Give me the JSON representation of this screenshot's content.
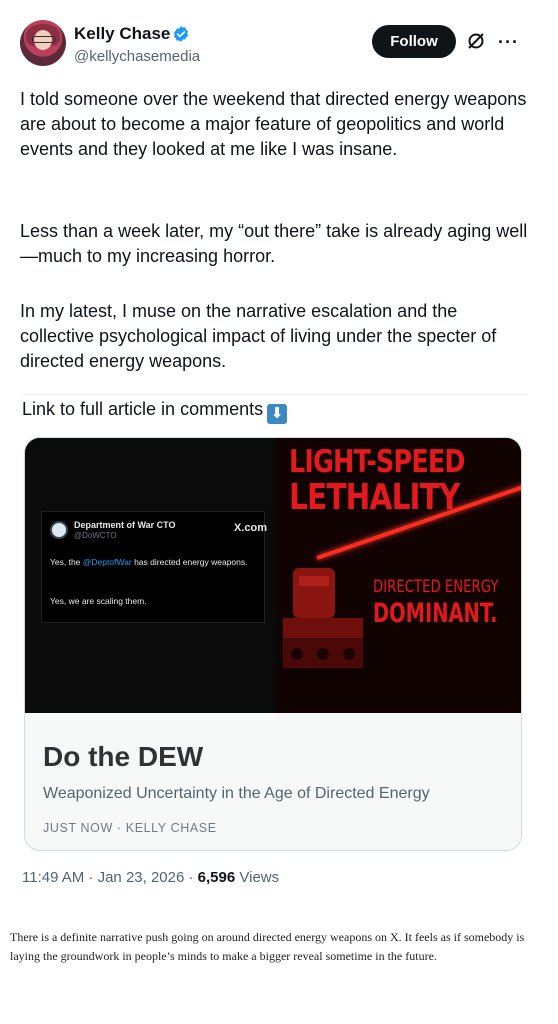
{
  "author": {
    "name": "Kelly Chase",
    "handle": "@kellychasemedia",
    "verified": true
  },
  "actions": {
    "follow_label": "Follow",
    "grok_icon": "grok-icon",
    "more_label": "···"
  },
  "post": {
    "paragraphs": [
      "I told someone over the weekend that directed energy weapons are about to become a major feature of geopolitics and world events and they looked at me like I was insane.",
      "Less than a week later, my “out there” take is already aging well—much to my increasing horror.",
      "In my latest, I muse on the narrative escalation and the collective psychological impact of living under the specter of directed energy weapons."
    ],
    "link_line": "Link to full article in comments",
    "link_emoji": "⬇"
  },
  "card": {
    "embed": {
      "account_name": "Department of War CTO",
      "account_handle": "@DoWCTO",
      "source": "X.com",
      "line1_prefix": "Yes, the ",
      "line1_mention": "@DeptofWar",
      "line1_suffix": " has directed energy weapons.",
      "line2": "Yes, we are scaling them."
    },
    "poster": {
      "headline1": "LIGHT-SPEED",
      "headline2": "LETHALITY",
      "sub1": "DIRECTED ENERGY",
      "sub2": "DOMINANT."
    },
    "title": "Do the DEW",
    "description": "Weaponized Uncertainty in the Age of Directed Energy",
    "meta": "JUST NOW · KELLY CHASE"
  },
  "stats": {
    "time": "11:49 AM · Jan 23, 2026 · ",
    "views_count": "6,596",
    "views_label": " Views"
  },
  "footer_note": "There is a definite narrative push going on around directed energy weapons on X. It feels as if somebody is laying the groundwork in people’s minds to make a bigger reveal sometime in the future.",
  "colors": {
    "accent_blue": "#1d9bf0",
    "poster_red": "#e3191d",
    "button_black": "#0f1419"
  }
}
